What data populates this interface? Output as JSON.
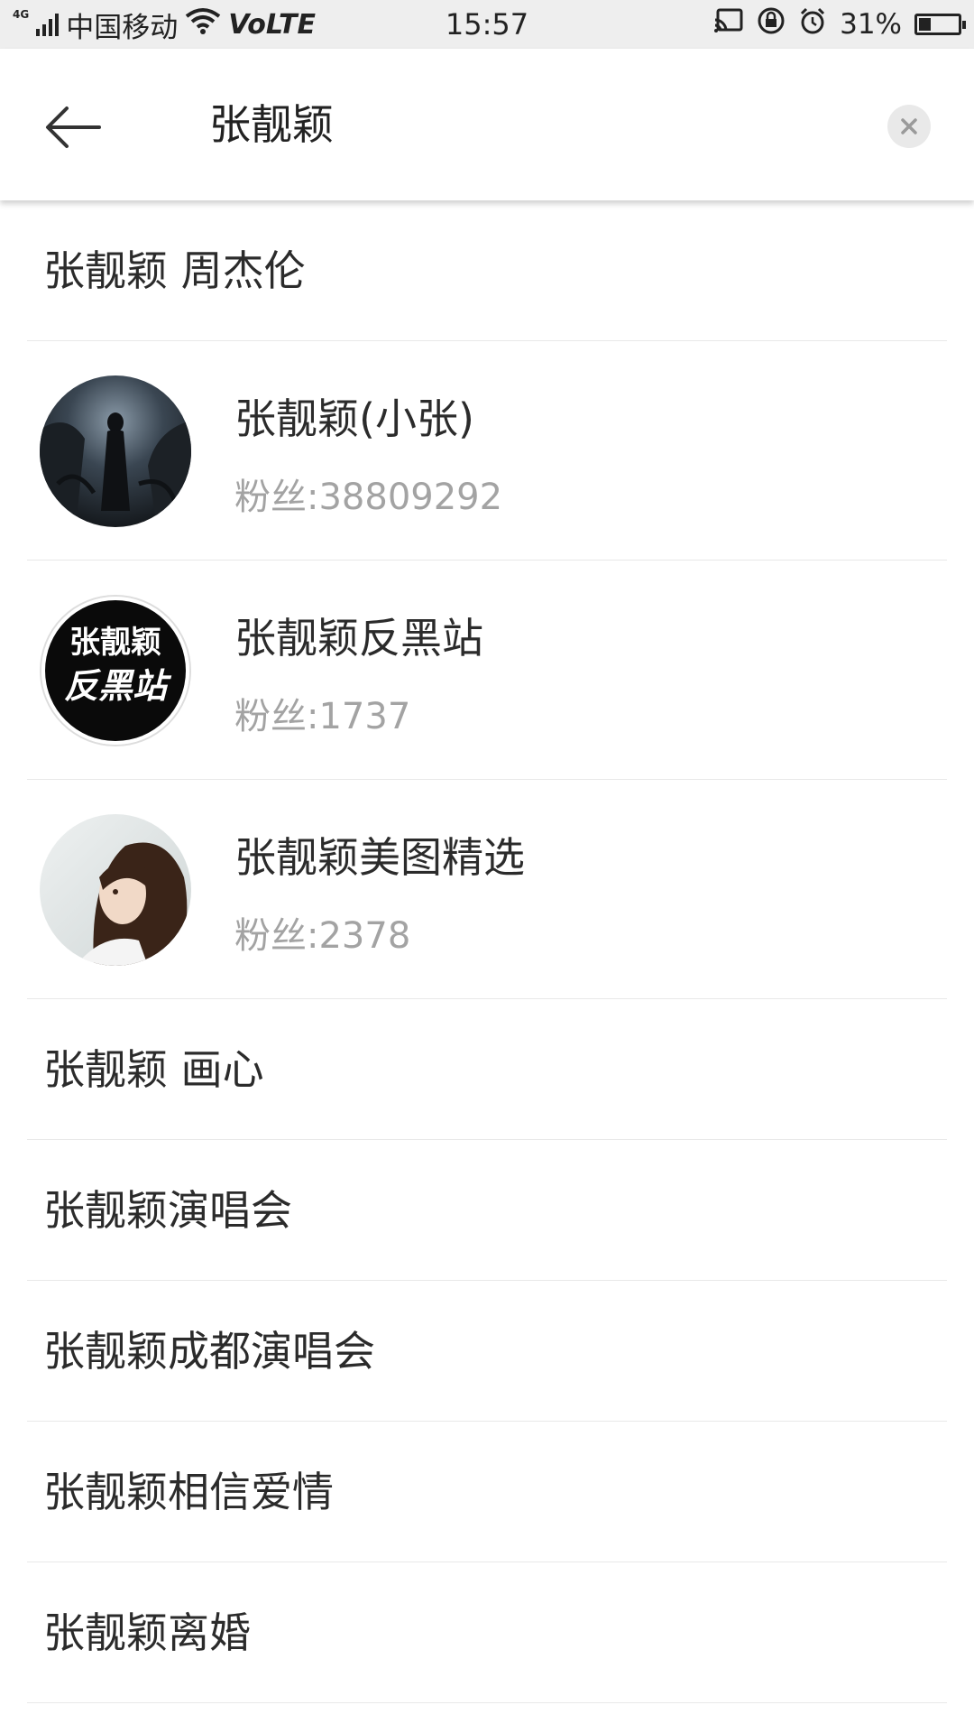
{
  "status_bar": {
    "network_type": "4G",
    "carrier": "中国移动",
    "volte": "VoLTE",
    "time": "15:57",
    "battery_text": "31%",
    "battery_level": 0.31
  },
  "search": {
    "query": "张靓颖"
  },
  "results": {
    "top_suggestion": "张靓颖 周杰伦",
    "users": [
      {
        "name": "张靓颖(小张)",
        "fans": "粉丝:38809292"
      },
      {
        "name": "张靓颖反黑站",
        "fans": "粉丝:1737",
        "avatar_text_top": "张靓颖",
        "avatar_text_bottom": "反黑站"
      },
      {
        "name": "张靓颖美图精选",
        "fans": "粉丝:2378"
      }
    ],
    "suggestions": [
      "张靓颖 画心",
      "张靓颖演唱会",
      "张靓颖成都演唱会",
      "张靓颖相信爱情",
      "张靓颖离婚"
    ]
  }
}
